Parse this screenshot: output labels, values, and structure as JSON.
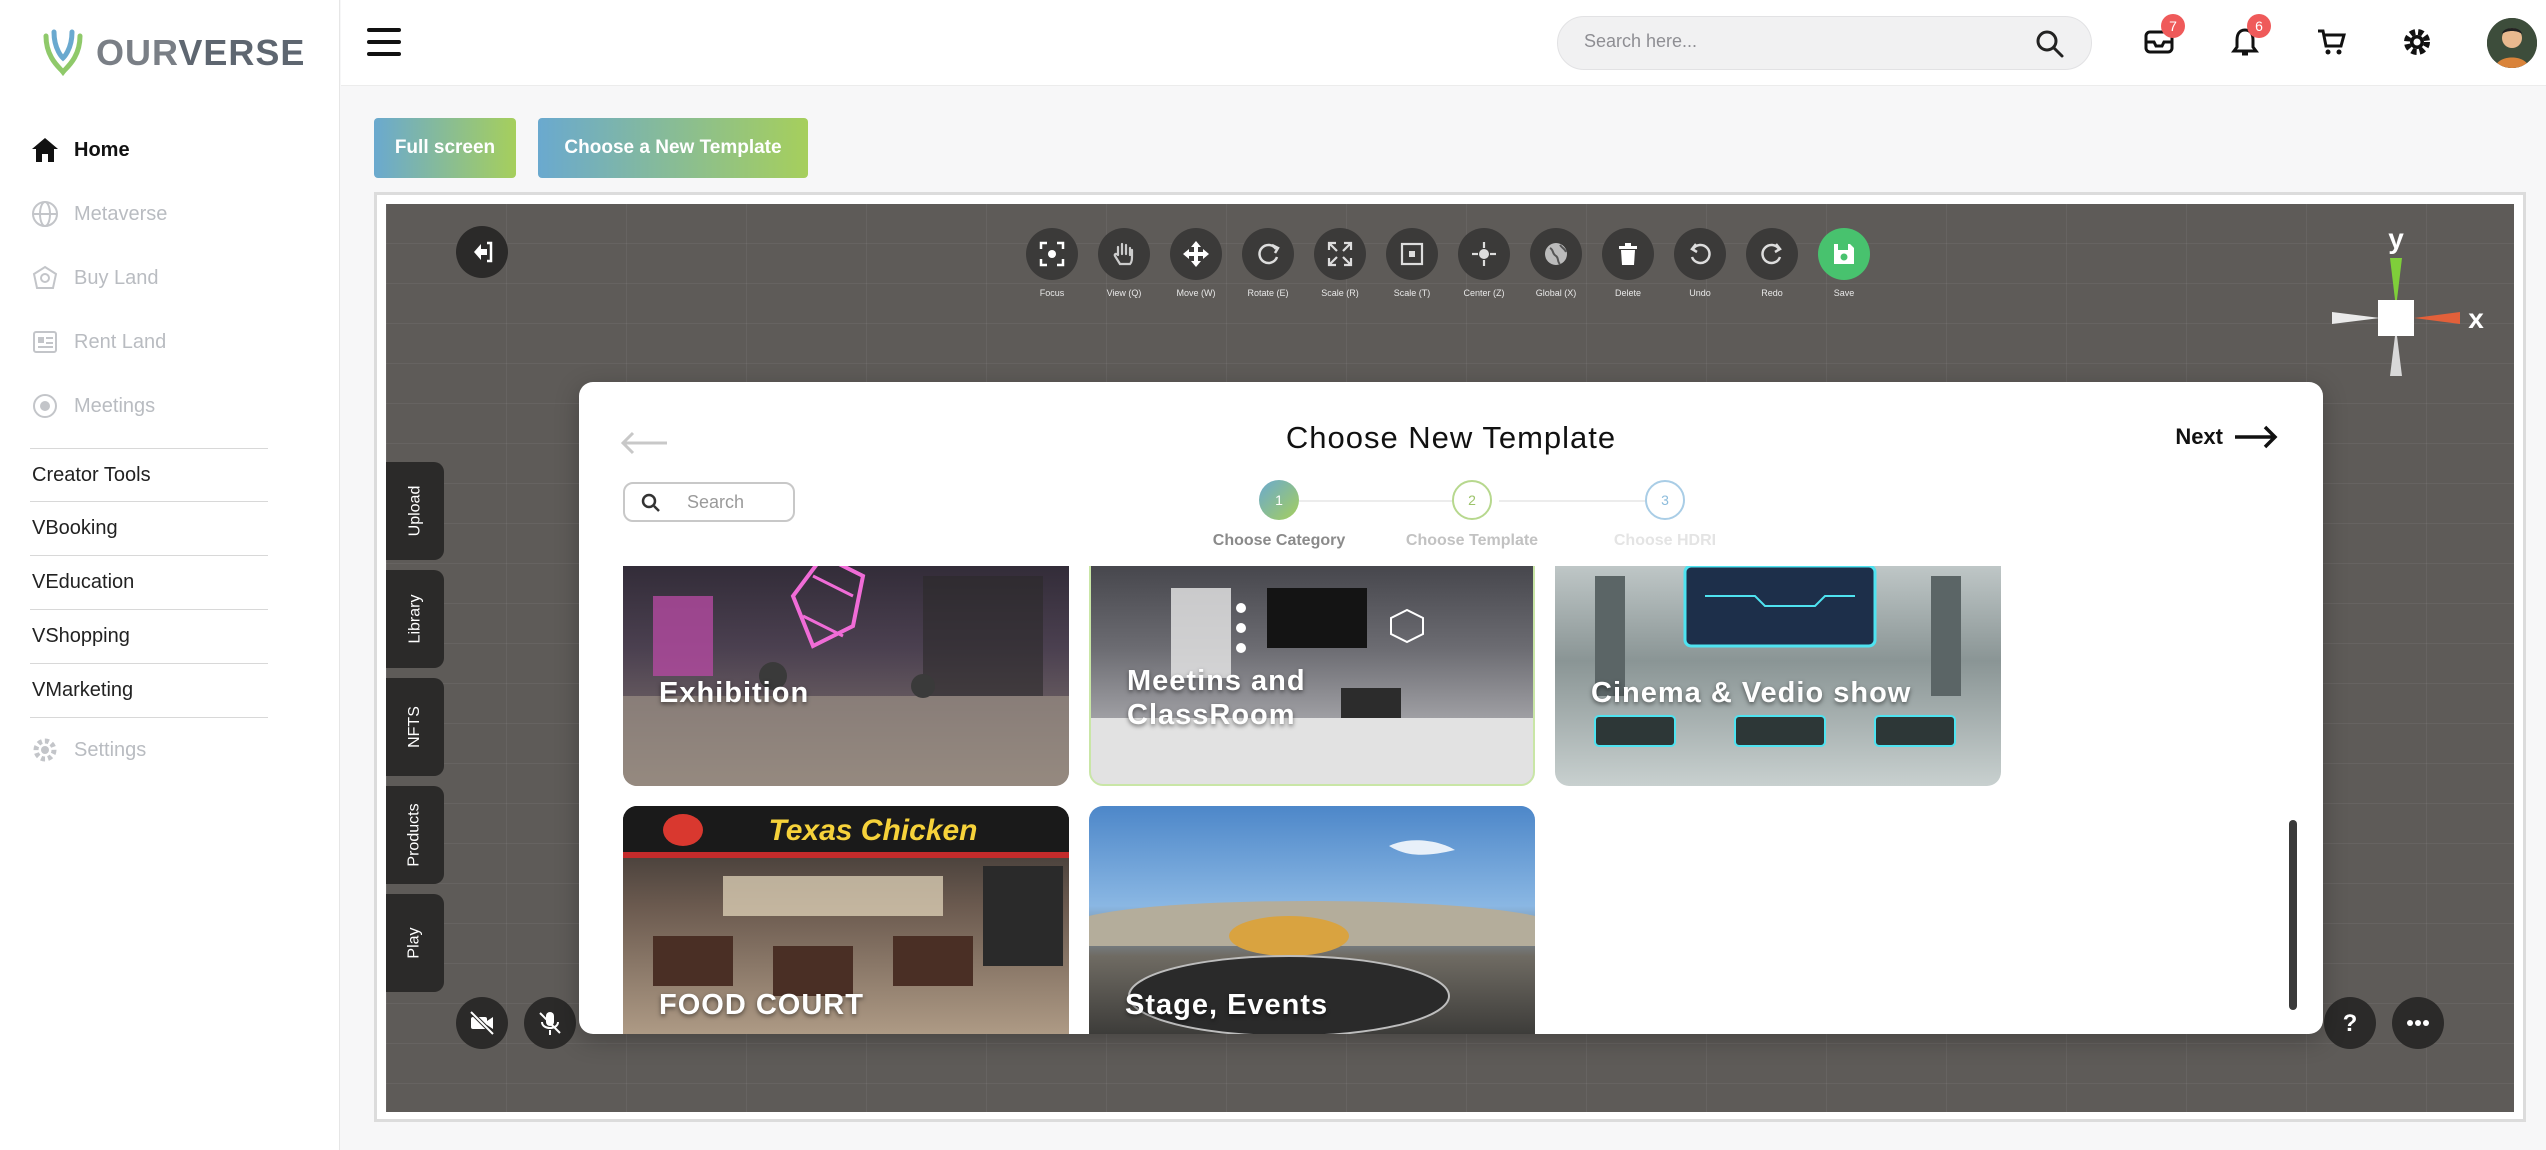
{
  "brand": {
    "name_light": "OUR",
    "name_bold": "VERSE"
  },
  "sidebar": {
    "items": [
      {
        "label": "Home",
        "icon": "home-icon",
        "active": true
      },
      {
        "label": "Metaverse",
        "icon": "globe-icon"
      },
      {
        "label": "Buy Land",
        "icon": "land-icon"
      },
      {
        "label": "Rent Land",
        "icon": "rent-icon"
      },
      {
        "label": "Meetings",
        "icon": "meetings-icon"
      }
    ],
    "sections": [
      "Creator Tools",
      "VBooking",
      "VEducation",
      "VShopping",
      "VMarketing"
    ],
    "settings_label": "Settings"
  },
  "header": {
    "search_placeholder": "Search here...",
    "messages_count": "7",
    "notifications_count": "6"
  },
  "actions": {
    "fullscreen": "Full screen",
    "choose_template": "Choose a New Template"
  },
  "toolbar": [
    {
      "label": "Focus",
      "icon": "focus-icon"
    },
    {
      "label": "View (Q)",
      "icon": "hand-icon"
    },
    {
      "label": "Move (W)",
      "icon": "move-icon"
    },
    {
      "label": "Rotate (E)",
      "icon": "rotate-icon"
    },
    {
      "label": "Scale (R)",
      "icon": "scale-icon"
    },
    {
      "label": "Scale (T)",
      "icon": "scale-box-icon"
    },
    {
      "label": "Center (Z)",
      "icon": "center-icon"
    },
    {
      "label": "Global (X)",
      "icon": "global-icon"
    },
    {
      "label": "Delete",
      "icon": "trash-icon"
    },
    {
      "label": "Undo",
      "icon": "undo-icon"
    },
    {
      "label": "Redo",
      "icon": "redo-icon"
    },
    {
      "label": "Save",
      "icon": "save-icon"
    }
  ],
  "side_tabs": [
    "Upload",
    "Library",
    "NFTS",
    "Products",
    "Play"
  ],
  "gizmo": {
    "x_label": "x",
    "y_label": "y"
  },
  "modal": {
    "title": "Choose New Template",
    "next_label": "Next",
    "search_placeholder": "Search",
    "steps": [
      {
        "number": "1",
        "label": "Choose Category"
      },
      {
        "number": "2",
        "label": "Choose Template"
      },
      {
        "number": "3",
        "label": "Choose HDRI"
      }
    ],
    "cards": [
      {
        "label": "Exhibition"
      },
      {
        "label": "Meetins and ClassRoom"
      },
      {
        "label": "Cinema & Vedio show"
      },
      {
        "label": "FOOD COURT",
        "sign": "Texas Chicken"
      },
      {
        "label": "Stage, Events"
      }
    ]
  },
  "colors": {
    "accent_start": "#6aa9cf",
    "accent_end": "#a6cf5c",
    "badge": "#ef5a5a",
    "save": "#48c26e"
  }
}
